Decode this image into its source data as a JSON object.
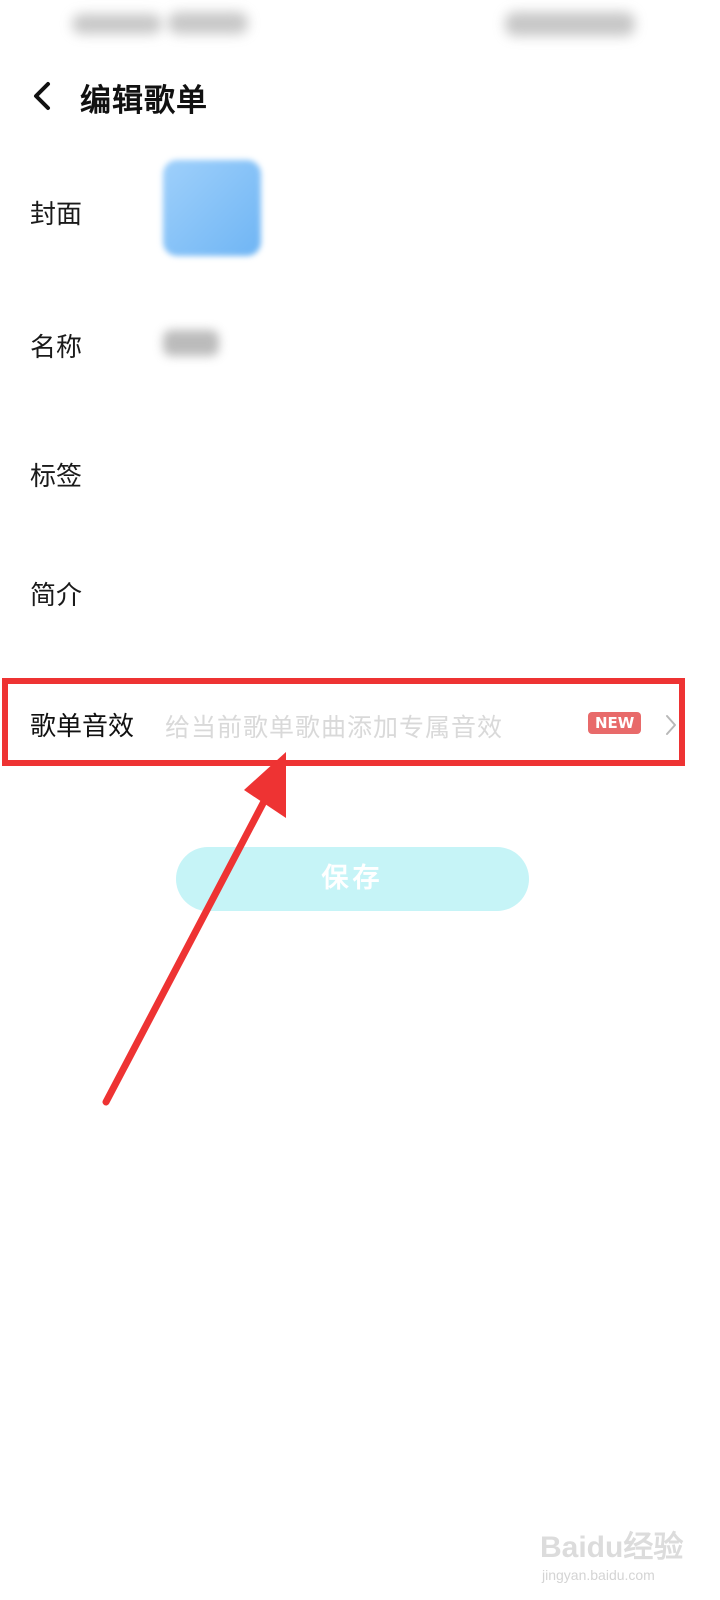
{
  "header": {
    "title": "编辑歌单",
    "back_icon": "chevron-left-icon"
  },
  "form": {
    "cover_label": "封面",
    "name_label": "名称",
    "tags_label": "标签",
    "intro_label": "简介"
  },
  "effect_row": {
    "label": "歌单音效",
    "hint": "给当前歌单歌曲添加专属音效",
    "badge": "NEW",
    "chevron_icon": "chevron-right-icon"
  },
  "save_button": {
    "label": "保存"
  },
  "watermark": {
    "main": "Baidu经验",
    "sub": "jingyan.baidu.com"
  },
  "colors": {
    "highlight": "#ee3333",
    "save_bg": "#c6f4f7",
    "badge_bg": "#e86a6a",
    "cover": "#7fbff6"
  }
}
